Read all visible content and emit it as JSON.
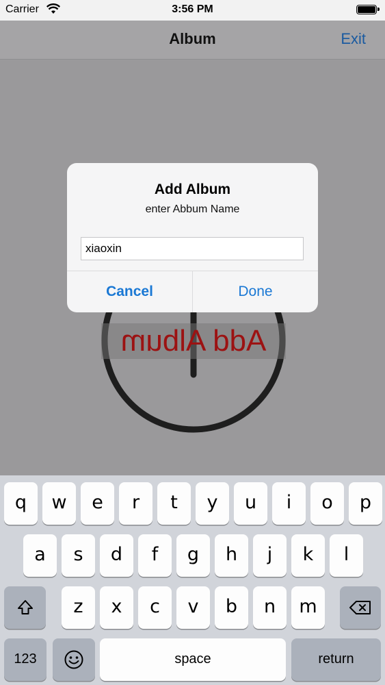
{
  "status_bar": {
    "carrier": "Carrier",
    "time": "3:56 PM"
  },
  "nav": {
    "title": "Album",
    "exit_label": "Exit"
  },
  "background_art": {
    "text": "Add Album",
    "text_color": "#9c1212"
  },
  "alert": {
    "title": "Add Album",
    "message": "enter Abbum Name",
    "input_value": "xiaoxin",
    "cancel_label": "Cancel",
    "done_label": "Done",
    "button_color": "#1a78d4"
  },
  "keyboard": {
    "row1": [
      "q",
      "w",
      "e",
      "r",
      "t",
      "y",
      "u",
      "i",
      "o",
      "p"
    ],
    "row2": [
      "a",
      "s",
      "d",
      "f",
      "g",
      "h",
      "j",
      "k",
      "l"
    ],
    "row3": [
      "z",
      "x",
      "c",
      "v",
      "b",
      "n",
      "m"
    ],
    "shift_icon": "shift-arrow-icon",
    "delete_icon": "backspace-icon",
    "numbers_label": "123",
    "emoji_icon": "emoji-smiley-icon",
    "space_label": "space",
    "return_label": "return"
  }
}
